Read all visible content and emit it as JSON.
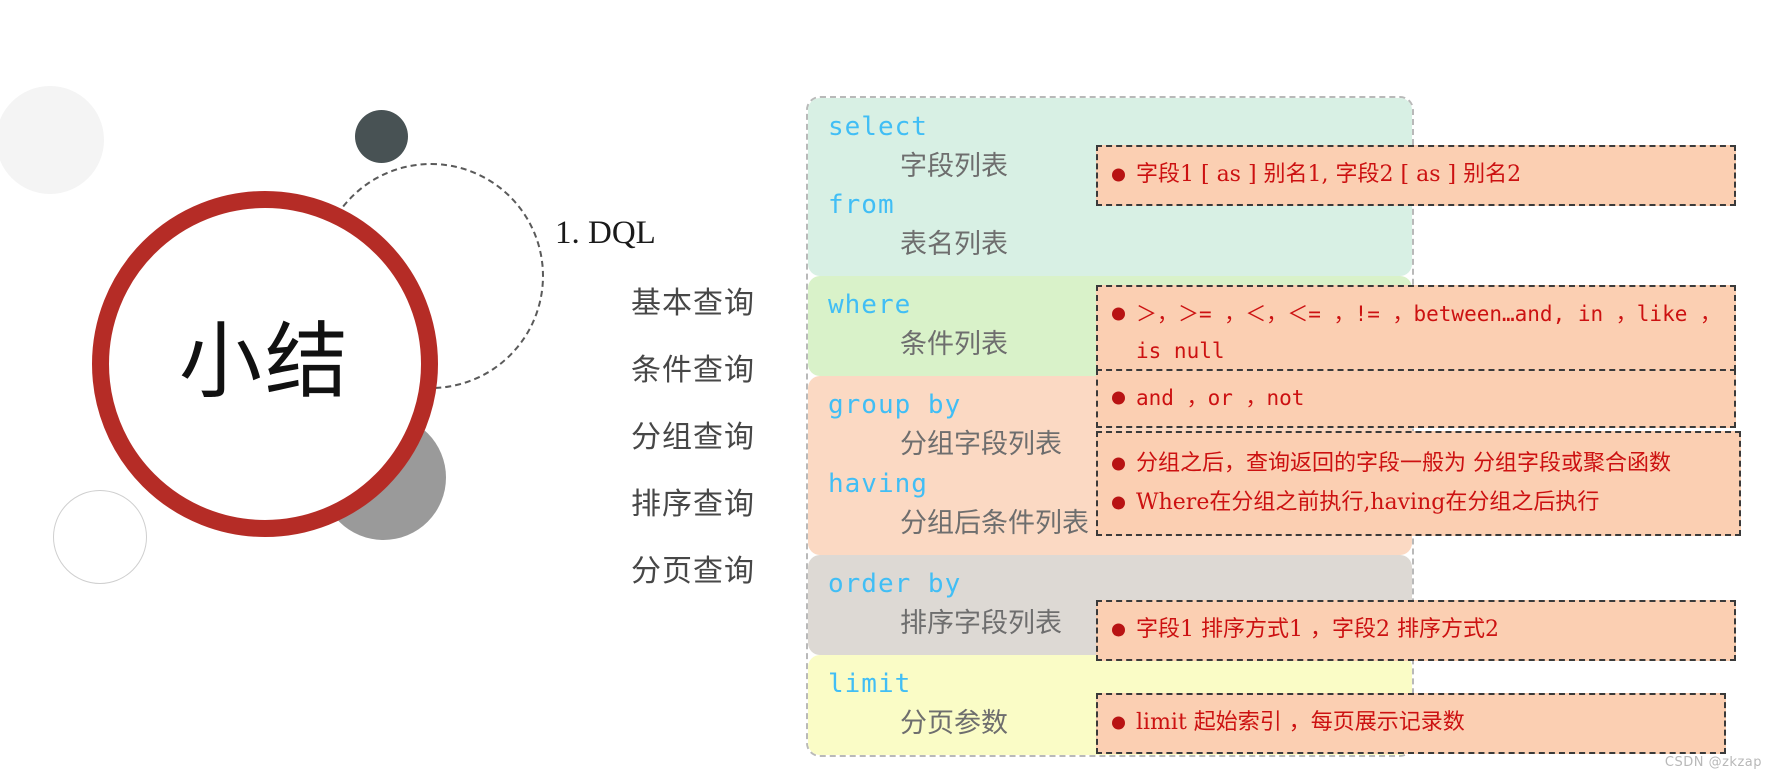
{
  "badge": {
    "title": "小结"
  },
  "outline": {
    "heading": "1.  DQL",
    "items": [
      {
        "label": "基本查询"
      },
      {
        "label": "条件查询"
      },
      {
        "label": "分组查询"
      },
      {
        "label": "排序查询"
      },
      {
        "label": "分页查询"
      }
    ]
  },
  "syntax": {
    "clauses": [
      {
        "keyword": "select",
        "argument": "字段列表",
        "color": "#d8f0e4"
      },
      {
        "keyword": "from",
        "argument": "表名列表",
        "color": "#d8f0e4"
      },
      {
        "keyword": "where",
        "argument": "条件列表",
        "color": "#d9f2c9"
      },
      {
        "keyword": "group  by",
        "argument": "分组字段列表",
        "color": "#fbd9c3"
      },
      {
        "keyword": "having",
        "argument": "分组后条件列表",
        "color": "#fbd9c3"
      },
      {
        "keyword": "order by",
        "argument": "排序字段列表",
        "color": "#ddd9d4"
      },
      {
        "keyword": "limit",
        "argument": "分页参数",
        "color": "#fafcc6"
      }
    ]
  },
  "callouts": {
    "select": {
      "line1": "字段1  [ as ]  别名1, 字段2  [ as ]  别名2"
    },
    "where": {
      "line1": "＞，＞= ，＜，＜= ，!= ，between…and, in ，like ，",
      "line2": "is null"
    },
    "and_or": {
      "line1": "and ，or  ，not"
    },
    "group": {
      "line1": "分组之后，查询返回的字段一般为 分组字段或聚合函数",
      "line2": "Where在分组之前执行,having在分组之后执行"
    },
    "order": {
      "line1": "字段1  排序方式1 ，字段2  排序方式2"
    },
    "limit": {
      "line1": "limit  起始索引 ，每页展示记录数"
    }
  },
  "watermark": {
    "text": "CSDN @zkzap"
  },
  "colors": {
    "ring": "#b52c26",
    "keyword": "#41bef5",
    "callout_text": "#cc1111",
    "callout_bg": "#fbcfb2",
    "argument_text": "#6e6e6e"
  }
}
